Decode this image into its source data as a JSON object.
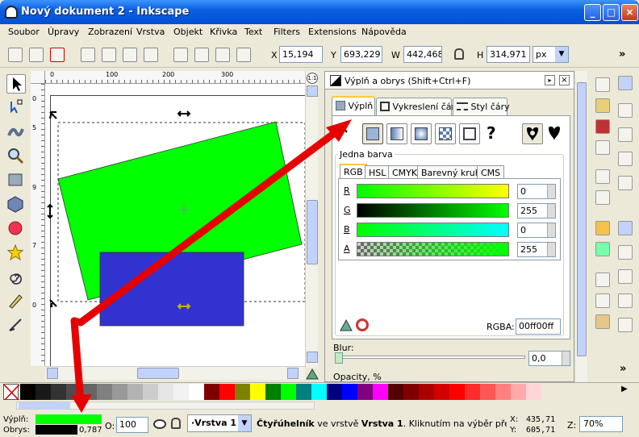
{
  "window": {
    "title": "Nový dokument 2 - Inkscape",
    "minimize": "_",
    "maximize": "□",
    "close": "×"
  },
  "menu": [
    "Soubor",
    "Úpravy",
    "Zobrazení",
    "Vrstva",
    "Objekt",
    "Křivka",
    "Text",
    "Filters",
    "Extensions",
    "Nápověda"
  ],
  "toolbar": {
    "x_label": "X",
    "x_value": "15,194",
    "y_label": "Y",
    "y_value": "693,229",
    "w_label": "W",
    "w_value": "442,468",
    "h_label": "H",
    "h_value": "314,971",
    "unit": "px",
    "overflow": "»"
  },
  "ruler": {
    "h_ticks": [
      "0",
      "100",
      "200",
      "300"
    ],
    "v_ticks": [
      "0",
      "5",
      "9",
      "7",
      "0"
    ]
  },
  "dock": {
    "title": "Výplň a obrys (Shift+Ctrl+F)",
    "tabs": [
      "Výplň",
      "Vykreslení čáry",
      "Styl čáry"
    ],
    "section": "Jedna barva",
    "color_tabs": [
      "RGB",
      "HSL",
      "CMYK",
      "Barevný kruh",
      "CMS"
    ],
    "channels": [
      {
        "label": "R",
        "value": "0"
      },
      {
        "label": "G",
        "value": "255"
      },
      {
        "label": "B",
        "value": "0"
      },
      {
        "label": "A",
        "value": "255"
      }
    ],
    "rgba_label": "RGBA:",
    "rgba_value": "00ff00ff",
    "blur_label": "Blur:",
    "blur_value": "0,0",
    "opacity_label": "Opacity, %",
    "unset_glyph": "×",
    "unknown_glyph": "?"
  },
  "status": {
    "fill_label": "Výplň:",
    "stroke_label": "Obrys:",
    "stroke_width": "0,787",
    "fill_color": "#00ff00",
    "stroke_color": "#000000",
    "opacity_label": "O:",
    "opacity_value": "100",
    "layer": "·Vrstva 1",
    "message_bold": "Čtyřúhelník",
    "message_mid": " ve vrstvě ",
    "message_layer": "Vrstva 1",
    "message_rest": ". Kliknutím na výběr přepnete",
    "x_label": "X:",
    "x_value": "435,71",
    "y_label": "Y:",
    "y_value": "605,71",
    "zoom_label": "Z:",
    "zoom_value": "70%"
  },
  "palette": [
    "#000000",
    "#1a1a1a",
    "#333333",
    "#4d4d4d",
    "#666666",
    "#808080",
    "#999999",
    "#b3b3b3",
    "#cccccc",
    "#e6e6e6",
    "#f2f2f2",
    "#ffffff",
    "#800000",
    "#ff0000",
    "#808000",
    "#ffff00",
    "#008000",
    "#00ff00",
    "#008080",
    "#00ffff",
    "#000080",
    "#0000ff",
    "#800080",
    "#ff00ff",
    "#550000",
    "#800000",
    "#aa0000",
    "#d40000",
    "#ff0000",
    "#ff2a2a",
    "#ff5555",
    "#ff8080",
    "#ffaaaa",
    "#ffd5d5"
  ],
  "colors": {
    "green_rect": "#00ff00",
    "blue_rect": "#3232d0",
    "arrow": "#e60000"
  }
}
